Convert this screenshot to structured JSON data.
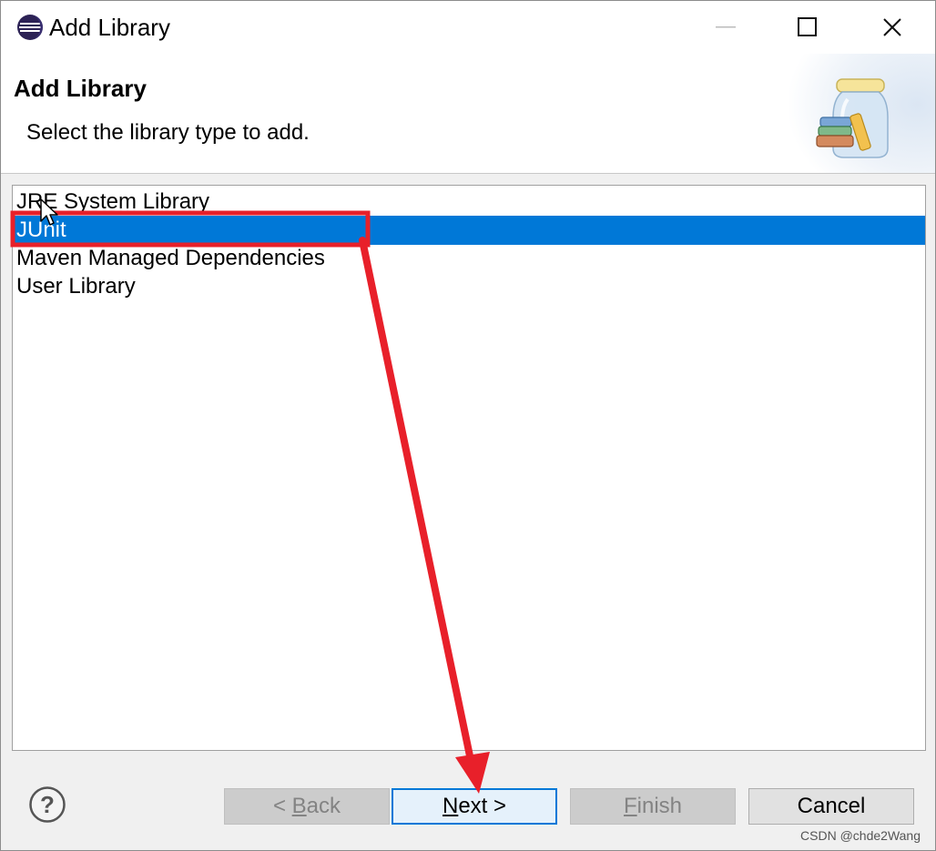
{
  "window": {
    "title": "Add Library"
  },
  "banner": {
    "title": "Add Library",
    "description": "Select the library type to add."
  },
  "library_list": {
    "items": [
      {
        "label": "JRE System Library",
        "selected": false
      },
      {
        "label": "JUnit",
        "selected": true
      },
      {
        "label": "Maven Managed Dependencies",
        "selected": false
      },
      {
        "label": "User Library",
        "selected": false
      }
    ]
  },
  "buttons": {
    "back": {
      "prefix": "< ",
      "mnemonic": "B",
      "rest": "ack",
      "enabled": false
    },
    "next": {
      "prefix": "",
      "mnemonic": "N",
      "rest": "ext >",
      "enabled": true
    },
    "finish": {
      "prefix": "",
      "mnemonic": "F",
      "rest": "inish",
      "enabled": false
    },
    "cancel": {
      "label": "Cancel",
      "enabled": true
    }
  },
  "watermark": "CSDN @chde2Wang",
  "colors": {
    "selection": "#0078d7",
    "annotation": "#e8202a",
    "default_button_border": "#0078d7"
  },
  "icons": {
    "app": "eclipse-icon",
    "banner": "library-jar-icon",
    "help": "help-icon"
  }
}
